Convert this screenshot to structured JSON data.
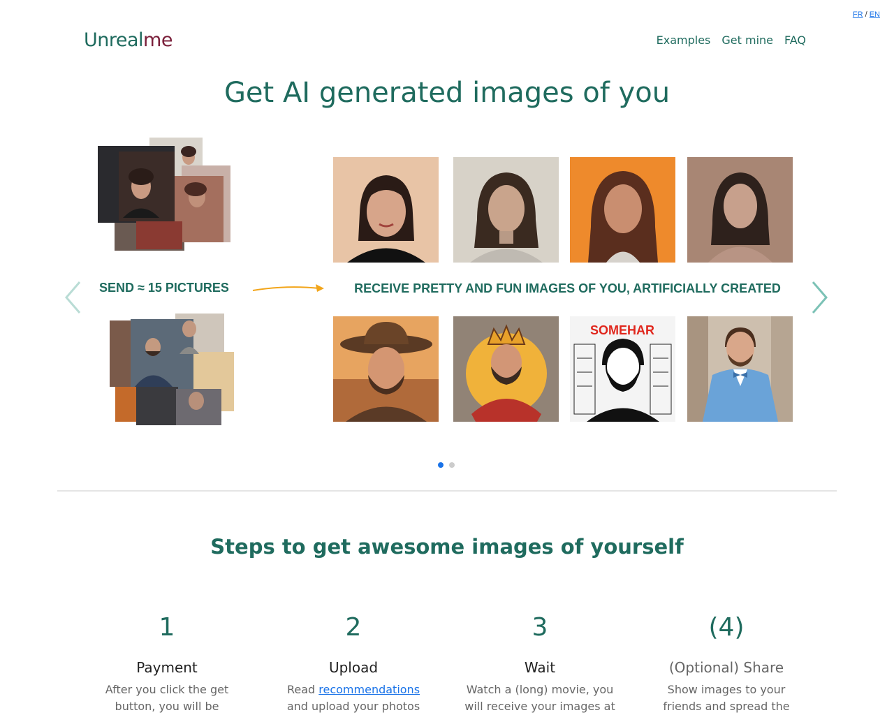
{
  "lang": {
    "fr": "FR",
    "sep": "/",
    "en": "EN"
  },
  "logo": {
    "part1": "Unreal",
    "part2": "me"
  },
  "nav": {
    "examples": "Examples",
    "get_mine": "Get mine",
    "faq": "FAQ"
  },
  "hero": {
    "title": "Get AI generated images of you",
    "send_label": "SEND ≈ 15 PICTURES",
    "receive_label": "RECEIVE PRETTY AND FUN IMAGES OF YOU, ARTIFICIALLY CREATED"
  },
  "carousel": {
    "slides": 2,
    "active_slide": 1
  },
  "portrait_thumbnail": {
    "text": "SOMEHAR"
  },
  "steps": {
    "title": "Steps to get awesome images of yourself",
    "items": [
      {
        "num": "1",
        "name": "Payment",
        "desc_line1": "After you click the get",
        "desc_line2": "button, you will be"
      },
      {
        "num": "2",
        "name": "Upload",
        "desc_pre": "Read ",
        "desc_link": "recommendations",
        "desc_line2": "and upload your photos"
      },
      {
        "num": "3",
        "name": "Wait",
        "desc_line1": "Watch a (long) movie, you",
        "desc_line2": "will receive your images at"
      },
      {
        "num": "(4)",
        "name": "(Optional) Share",
        "desc_line1": "Show images to your",
        "desc_line2": "friends and spread the"
      }
    ]
  }
}
